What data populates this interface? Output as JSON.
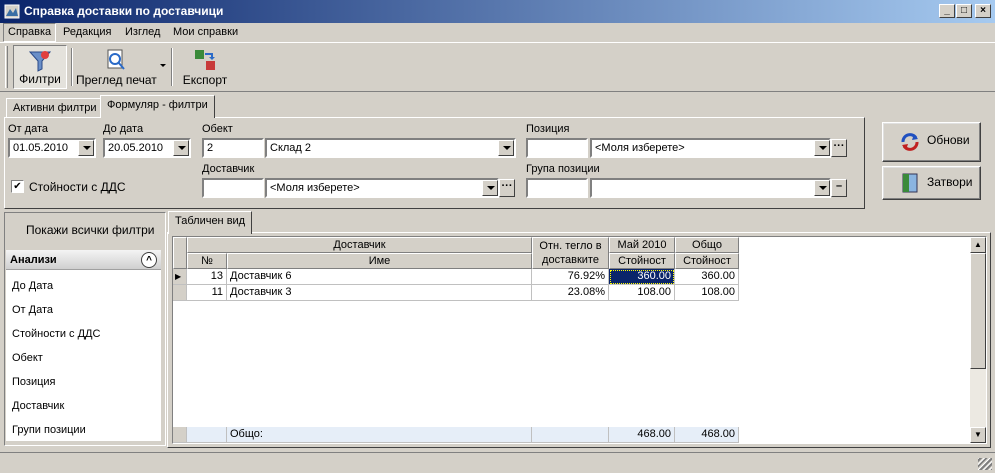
{
  "window": {
    "title": "Справка доставки по доставчици",
    "minimize": "_",
    "maximize": "□",
    "close": "×"
  },
  "menu": [
    "Справка",
    "Редакция",
    "Изглед",
    "Мои справки"
  ],
  "toolbar": {
    "filters": "Филтри",
    "print_preview": "Преглед печат",
    "export": "Експорт"
  },
  "filter_tabs": [
    "Активни филтри",
    "Формуляр - филтри"
  ],
  "filters": {
    "from_date_label": "От дата",
    "from_date": "01.05.2010",
    "to_date_label": "До дата",
    "to_date": "20.05.2010",
    "object_label": "Обект",
    "object_code": "2",
    "object_name": "Склад 2",
    "position_label": "Позиция",
    "position_code": "",
    "position_name": "<Моля изберете>",
    "supplier_label": "Доставчик",
    "supplier_code": "",
    "supplier_name": "<Моля изберете>",
    "group_label": "Група позиции",
    "group_code": "",
    "group_name": "",
    "vat_label": "Стойности с ДДС",
    "vat_checked": "✔",
    "ellipsis": "···",
    "dash": "–"
  },
  "actions": {
    "refresh": "Обнови",
    "close": "Затвори"
  },
  "side": {
    "show_all": "Покажи всички филтри",
    "section": "Анализи",
    "collapse": "^",
    "items": [
      "До Дата",
      "От Дата",
      "Стойности с ДДС",
      "Обект",
      "Позиция",
      "Доставчик",
      "Групи позиции"
    ]
  },
  "grid": {
    "tab": "Табличен вид",
    "group_headers": [
      "Доставчик",
      "Отн. тегло в доставките",
      "Май 2010",
      "Общо"
    ],
    "col_headers": [
      "№",
      "Име",
      "Стойност",
      "Стойност"
    ],
    "rows": [
      {
        "no": "13",
        "name": "Доставчик 6",
        "share": "76.92%",
        "may": "360.00",
        "total": "360.00"
      },
      {
        "no": "11",
        "name": "Доставчик 3",
        "share": "23.08%",
        "may": "108.00",
        "total": "108.00"
      }
    ],
    "footer": {
      "label": "Общо:",
      "may": "468.00",
      "total": "468.00"
    },
    "row_marker": "▶",
    "scroll_up": "▲",
    "scroll_down": "▼"
  }
}
